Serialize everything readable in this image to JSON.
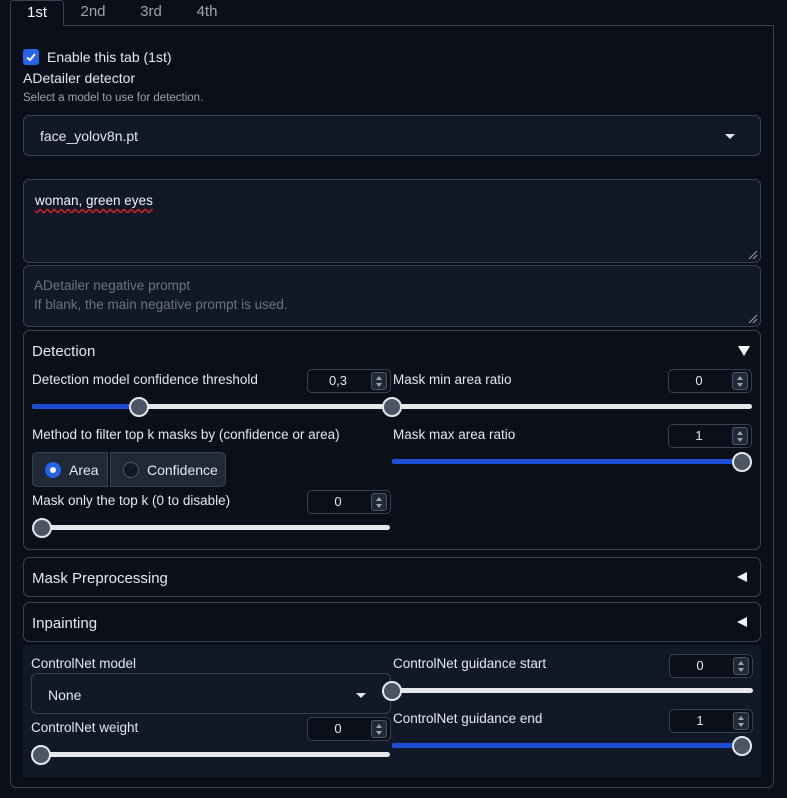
{
  "tabs": [
    "1st",
    "2nd",
    "3rd",
    "4th"
  ],
  "enable": {
    "label": "Enable this tab (1st)",
    "checked": true
  },
  "detector": {
    "label": "ADetailer detector",
    "hint": "Select a model to use for detection.",
    "value": "face_yolov8n.pt"
  },
  "prompt": {
    "value": "woman, green eyes"
  },
  "negative_prompt": {
    "placeholder_line1": "ADetailer negative prompt",
    "placeholder_line2": "If blank, the main negative prompt is used."
  },
  "detection": {
    "title": "Detection",
    "confidence": {
      "label": "Detection model confidence threshold",
      "value": "0,3",
      "fraction": 0.3
    },
    "mask_min": {
      "label": "Mask min area ratio",
      "value": "0",
      "fraction": 0.0
    },
    "filter_method": {
      "label": "Method to filter top k masks by (confidence or area)",
      "options": [
        "Area",
        "Confidence"
      ],
      "selected": "Area"
    },
    "mask_max": {
      "label": "Mask max area ratio",
      "value": "1",
      "fraction": 1.0
    },
    "top_k": {
      "label": "Mask only the top k (0 to disable)",
      "value": "0",
      "fraction": 0.0
    }
  },
  "mask_preprocessing": {
    "title": "Mask Preprocessing"
  },
  "inpainting": {
    "title": "Inpainting"
  },
  "controlnet": {
    "model": {
      "label": "ControlNet model",
      "value": "None"
    },
    "weight": {
      "label": "ControlNet weight",
      "value": "0",
      "fraction": 0.0
    },
    "guidance_start": {
      "label": "ControlNet guidance start",
      "value": "0",
      "fraction": 0.0
    },
    "guidance_end": {
      "label": "ControlNet guidance end",
      "value": "1",
      "fraction": 1.0
    }
  },
  "colors": {
    "accent": "#2563eb",
    "slider_fill": "#1d4ed8",
    "background": "#0b0f19"
  }
}
